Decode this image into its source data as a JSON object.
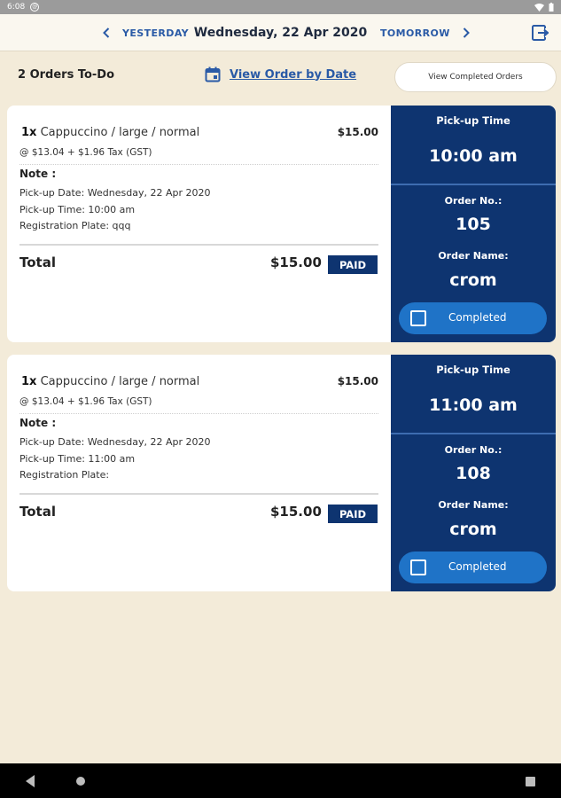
{
  "status_bar": {
    "time": "6:08",
    "notification_icon": "@"
  },
  "nav": {
    "prev_label": "YESTERDAY",
    "date_label": "Wednesday, 22 Apr 2020",
    "next_label": "TOMORROW"
  },
  "toolbar": {
    "orders_count": "2  Orders To-Do",
    "by_date_label": "View Order by Date",
    "completed_label": "View Completed Orders"
  },
  "orders": [
    {
      "qty": "1x",
      "item": "Cappuccino / large / normal",
      "price": "$15.00",
      "tax_line": "@ $13.04 + $1.96 Tax (GST)",
      "note_label": "Note :",
      "pickup_date": "Pick-up Date: Wednesday, 22 Apr 2020",
      "pickup_time_line": "Pick-up Time: 10:00 am",
      "registration": "Registration Plate: qqq",
      "total_label": "Total",
      "total_value": "$15.00",
      "paid_label": "PAID",
      "pickup_label": "Pick-up Time",
      "pickup_time": "10:00 am",
      "order_no_label": "Order No.:",
      "order_no": "105",
      "order_name_label": "Order Name:",
      "order_name": "crom",
      "completed_label": "Completed"
    },
    {
      "qty": "1x",
      "item": "Cappuccino / large / normal",
      "price": "$15.00",
      "tax_line": "@ $13.04 + $1.96 Tax (GST)",
      "note_label": "Note :",
      "pickup_date": "Pick-up Date: Wednesday, 22 Apr 2020",
      "pickup_time_line": "Pick-up Time: 11:00 am",
      "registration": "Registration Plate:",
      "total_label": "Total",
      "total_value": "$15.00",
      "paid_label": "PAID",
      "pickup_label": "Pick-up Time",
      "pickup_time": "11:00 am",
      "order_no_label": "Order No.:",
      "order_no": "108",
      "order_name_label": "Order Name:",
      "order_name": "crom",
      "completed_label": "Completed"
    }
  ],
  "colors": {
    "background": "#f3ebd9",
    "navy": "#0e3470",
    "accent_blue": "#2a5aa6",
    "button_blue": "#1f73c7"
  }
}
